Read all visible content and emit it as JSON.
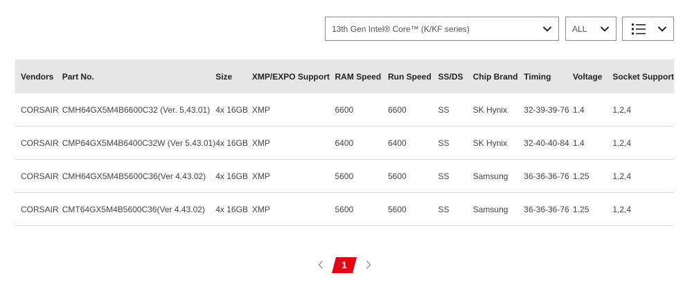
{
  "filters": {
    "cpu_select": {
      "value": "13th Gen Intel® Core™ (K/KF series)",
      "icon": "chevron-down-icon"
    },
    "type_select": {
      "value": "ALL",
      "icon": "chevron-down-icon"
    },
    "view_select": {
      "icon": "list-view-icon"
    }
  },
  "table": {
    "headers": [
      "Vendors",
      "Part No.",
      "Size",
      "XMP/EXPO Support",
      "RAM Speed",
      "Run Speed",
      "SS/DS",
      "Chip Brand",
      "Timing",
      "Voltage",
      "Socket Support"
    ],
    "rows": [
      [
        "CORSAIR",
        "CMH64GX5M4B6600C32 (Ver. 5.43.01)",
        "4x 16GB",
        "XMP",
        "6600",
        "6600",
        "SS",
        "SK Hynix",
        "32-39-39-76",
        "1.4",
        "1,2,4"
      ],
      [
        "CORSAIR",
        "CMP64GX5M4B6400C32W (Ver 5.43.01)",
        "4x 16GB",
        "XMP",
        "6400",
        "6400",
        "SS",
        "SK Hynix",
        "32-40-40-84",
        "1.4",
        "1,2,4"
      ],
      [
        "CORSAIR",
        "CMH64GX5M4B5600C36(Ver 4.43.02)",
        "4x 16GB",
        "XMP",
        "5600",
        "5600",
        "SS",
        "Samsung",
        "36-36-36-76",
        "1.25",
        "1,2,4"
      ],
      [
        "CORSAIR",
        "CMT64GX5M4B5600C36(Ver 4.43.02)",
        "4x 16GB",
        "XMP",
        "5600",
        "5600",
        "SS",
        "Samsung",
        "36-36-36-76",
        "1.25",
        "1,2,4"
      ]
    ]
  },
  "pagination": {
    "current_page": "1",
    "active_color": "#e60012"
  }
}
